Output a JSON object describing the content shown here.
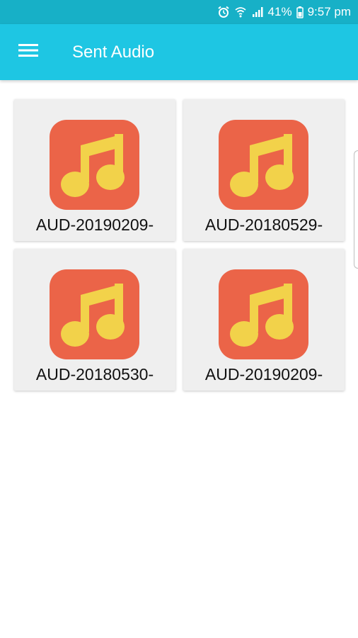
{
  "status_bar": {
    "icons": [
      "alarm-icon",
      "wifi-icon",
      "signal-icon",
      "battery-icon"
    ],
    "battery": "41%",
    "time": "9:57 pm"
  },
  "app_bar": {
    "title": "Sent Audio",
    "menu_icon": "hamburger-menu-icon"
  },
  "files": [
    {
      "name": "AUD-20190209-",
      "icon": "music-note-icon"
    },
    {
      "name": "AUD-20180529-",
      "icon": "music-note-icon"
    },
    {
      "name": "AUD-20180530-",
      "icon": "music-note-icon"
    },
    {
      "name": "AUD-20190209-",
      "icon": "music-note-icon"
    }
  ],
  "colors": {
    "status_bar": "#17b0c7",
    "app_bar": "#1ec6e3",
    "icon_background": "#eb6448",
    "icon_note": "#f2d24a",
    "card_background": "#efefef"
  }
}
